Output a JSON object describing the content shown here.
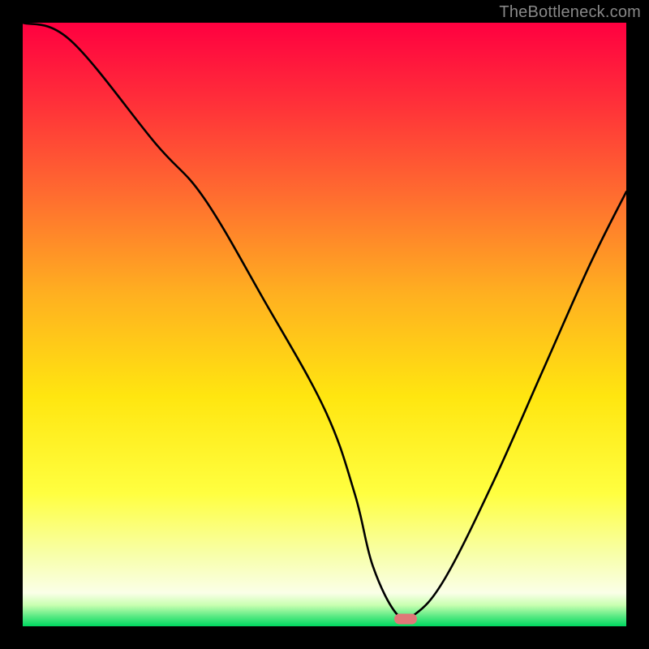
{
  "watermark": "TheBottleneck.com",
  "chart_data": {
    "type": "line",
    "title": "",
    "xlabel": "",
    "ylabel": "",
    "xlim": [
      0,
      100
    ],
    "ylim": [
      0,
      100
    ],
    "grid": false,
    "legend": false,
    "series": [
      {
        "name": "bottleneck-curve",
        "x": [
          0,
          8,
          22,
          30,
          40,
          50,
          55,
          58,
          62,
          65,
          70,
          78,
          86,
          94,
          100
        ],
        "values": [
          100,
          97,
          80,
          71,
          54,
          36,
          22,
          10,
          2,
          2,
          8,
          24,
          42,
          60,
          72
        ],
        "color": "#000000"
      }
    ],
    "marker": {
      "x": 63.5,
      "y": 1.2,
      "color": "#e07878"
    },
    "background_gradient": {
      "stops": [
        {
          "offset": 0.0,
          "color": "#ff0040"
        },
        {
          "offset": 0.12,
          "color": "#ff2b3a"
        },
        {
          "offset": 0.28,
          "color": "#ff6a30"
        },
        {
          "offset": 0.45,
          "color": "#ffb020"
        },
        {
          "offset": 0.62,
          "color": "#ffe610"
        },
        {
          "offset": 0.78,
          "color": "#ffff40"
        },
        {
          "offset": 0.88,
          "color": "#f8ffa8"
        },
        {
          "offset": 0.945,
          "color": "#faffe8"
        },
        {
          "offset": 0.965,
          "color": "#c8ffb0"
        },
        {
          "offset": 0.985,
          "color": "#50e880"
        },
        {
          "offset": 1.0,
          "color": "#00d860"
        }
      ]
    }
  }
}
